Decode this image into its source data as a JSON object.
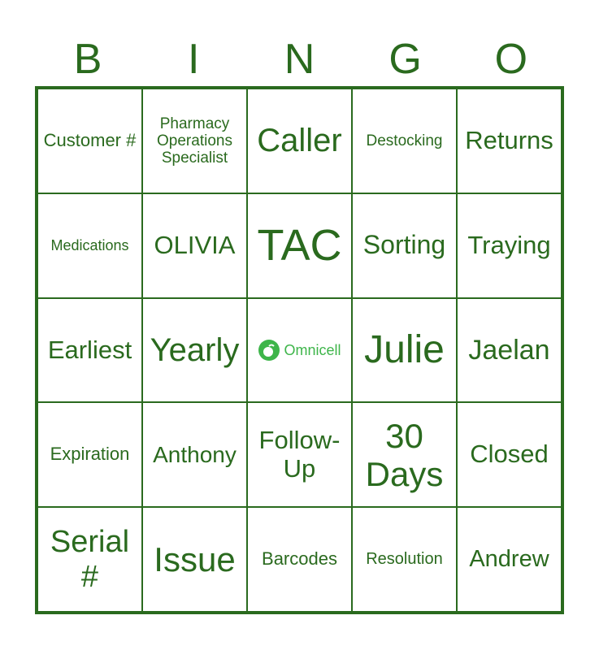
{
  "header": {
    "letters": [
      "B",
      "I",
      "N",
      "G",
      "O"
    ]
  },
  "colors": {
    "accent": "#2a6a1e",
    "logo": "#3eb54a"
  },
  "cells": [
    {
      "text": "Customer #",
      "size": 22
    },
    {
      "text": "Pharmacy Operations Specialist",
      "size": 19
    },
    {
      "text": "Caller",
      "size": 40
    },
    {
      "text": "Destocking",
      "size": 19
    },
    {
      "text": "Returns",
      "size": 31
    },
    {
      "text": "Medications",
      "size": 18
    },
    {
      "text": "OLIVIA",
      "size": 31
    },
    {
      "text": "TAC",
      "size": 54
    },
    {
      "text": "Sorting",
      "size": 32
    },
    {
      "text": "Traying",
      "size": 31
    },
    {
      "text": "Earliest",
      "size": 31
    },
    {
      "text": "Yearly",
      "size": 40
    },
    {
      "text": "",
      "logo": "Omnicell",
      "icon": "omnicell-logo-icon"
    },
    {
      "text": "Julie",
      "size": 48
    },
    {
      "text": "Jaelan",
      "size": 34
    },
    {
      "text": "Expiration",
      "size": 22
    },
    {
      "text": "Anthony",
      "size": 28
    },
    {
      "text": "Follow-Up",
      "size": 31
    },
    {
      "text": "30 Days",
      "size": 42
    },
    {
      "text": "Closed",
      "size": 31
    },
    {
      "text": "Serial #",
      "size": 38
    },
    {
      "text": "Issue",
      "size": 42
    },
    {
      "text": "Barcodes",
      "size": 22
    },
    {
      "text": "Resolution",
      "size": 20
    },
    {
      "text": "Andrew",
      "size": 29
    }
  ]
}
